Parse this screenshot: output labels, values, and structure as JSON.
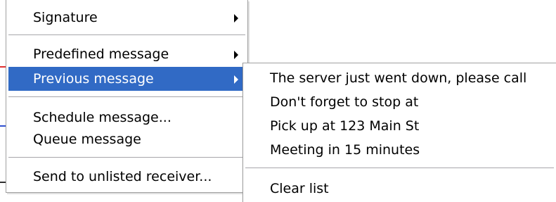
{
  "main_menu": {
    "items": [
      {
        "label": "Signature",
        "has_submenu": true
      },
      {
        "label": "Predefined message",
        "has_submenu": true
      },
      {
        "label": "Previous message",
        "has_submenu": true,
        "selected": true
      },
      {
        "label": "Schedule message...",
        "has_submenu": false
      },
      {
        "label": "Queue message",
        "has_submenu": false
      },
      {
        "label": "Send to unlisted receiver...",
        "has_submenu": false
      }
    ]
  },
  "submenu": {
    "items": [
      {
        "label": "The server just went down, please call"
      },
      {
        "label": "Don't forget to stop at"
      },
      {
        "label": "Pick up at 123 Main St"
      },
      {
        "label": "Meeting in 15 minutes"
      },
      {
        "label": "Clear list"
      }
    ]
  },
  "colors": {
    "highlight": "#316ac5",
    "highlight_text": "#ffffff",
    "separator": "#a7a6aa"
  }
}
